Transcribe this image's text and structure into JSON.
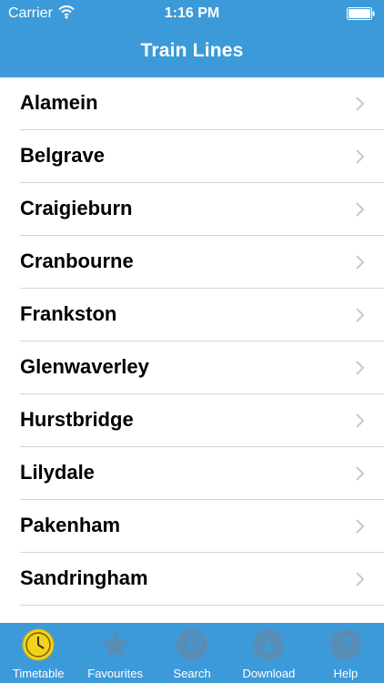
{
  "status_bar": {
    "carrier": "Carrier",
    "time": "1:16 PM"
  },
  "header": {
    "title": "Train Lines"
  },
  "lines": [
    {
      "name": "Alamein"
    },
    {
      "name": "Belgrave"
    },
    {
      "name": "Craigieburn"
    },
    {
      "name": "Cranbourne"
    },
    {
      "name": "Frankston"
    },
    {
      "name": "Glenwaverley"
    },
    {
      "name": "Hurstbridge"
    },
    {
      "name": "Lilydale"
    },
    {
      "name": "Pakenham"
    },
    {
      "name": "Sandringham"
    }
  ],
  "tabs": [
    {
      "label": "Timetable",
      "icon": "clock-icon",
      "selected": true
    },
    {
      "label": "Favourites",
      "icon": "star-icon",
      "selected": false
    },
    {
      "label": "Search",
      "icon": "search-icon",
      "selected": false
    },
    {
      "label": "Download",
      "icon": "download-icon",
      "selected": false
    },
    {
      "label": "Help",
      "icon": "help-icon",
      "selected": false
    }
  ],
  "colors": {
    "bar": "#3d9ad8",
    "tab_selected": "#f2d21b",
    "tab_inactive": "#5a8db5",
    "separator": "#d6d6d6",
    "chevron": "#c7c7cc"
  }
}
